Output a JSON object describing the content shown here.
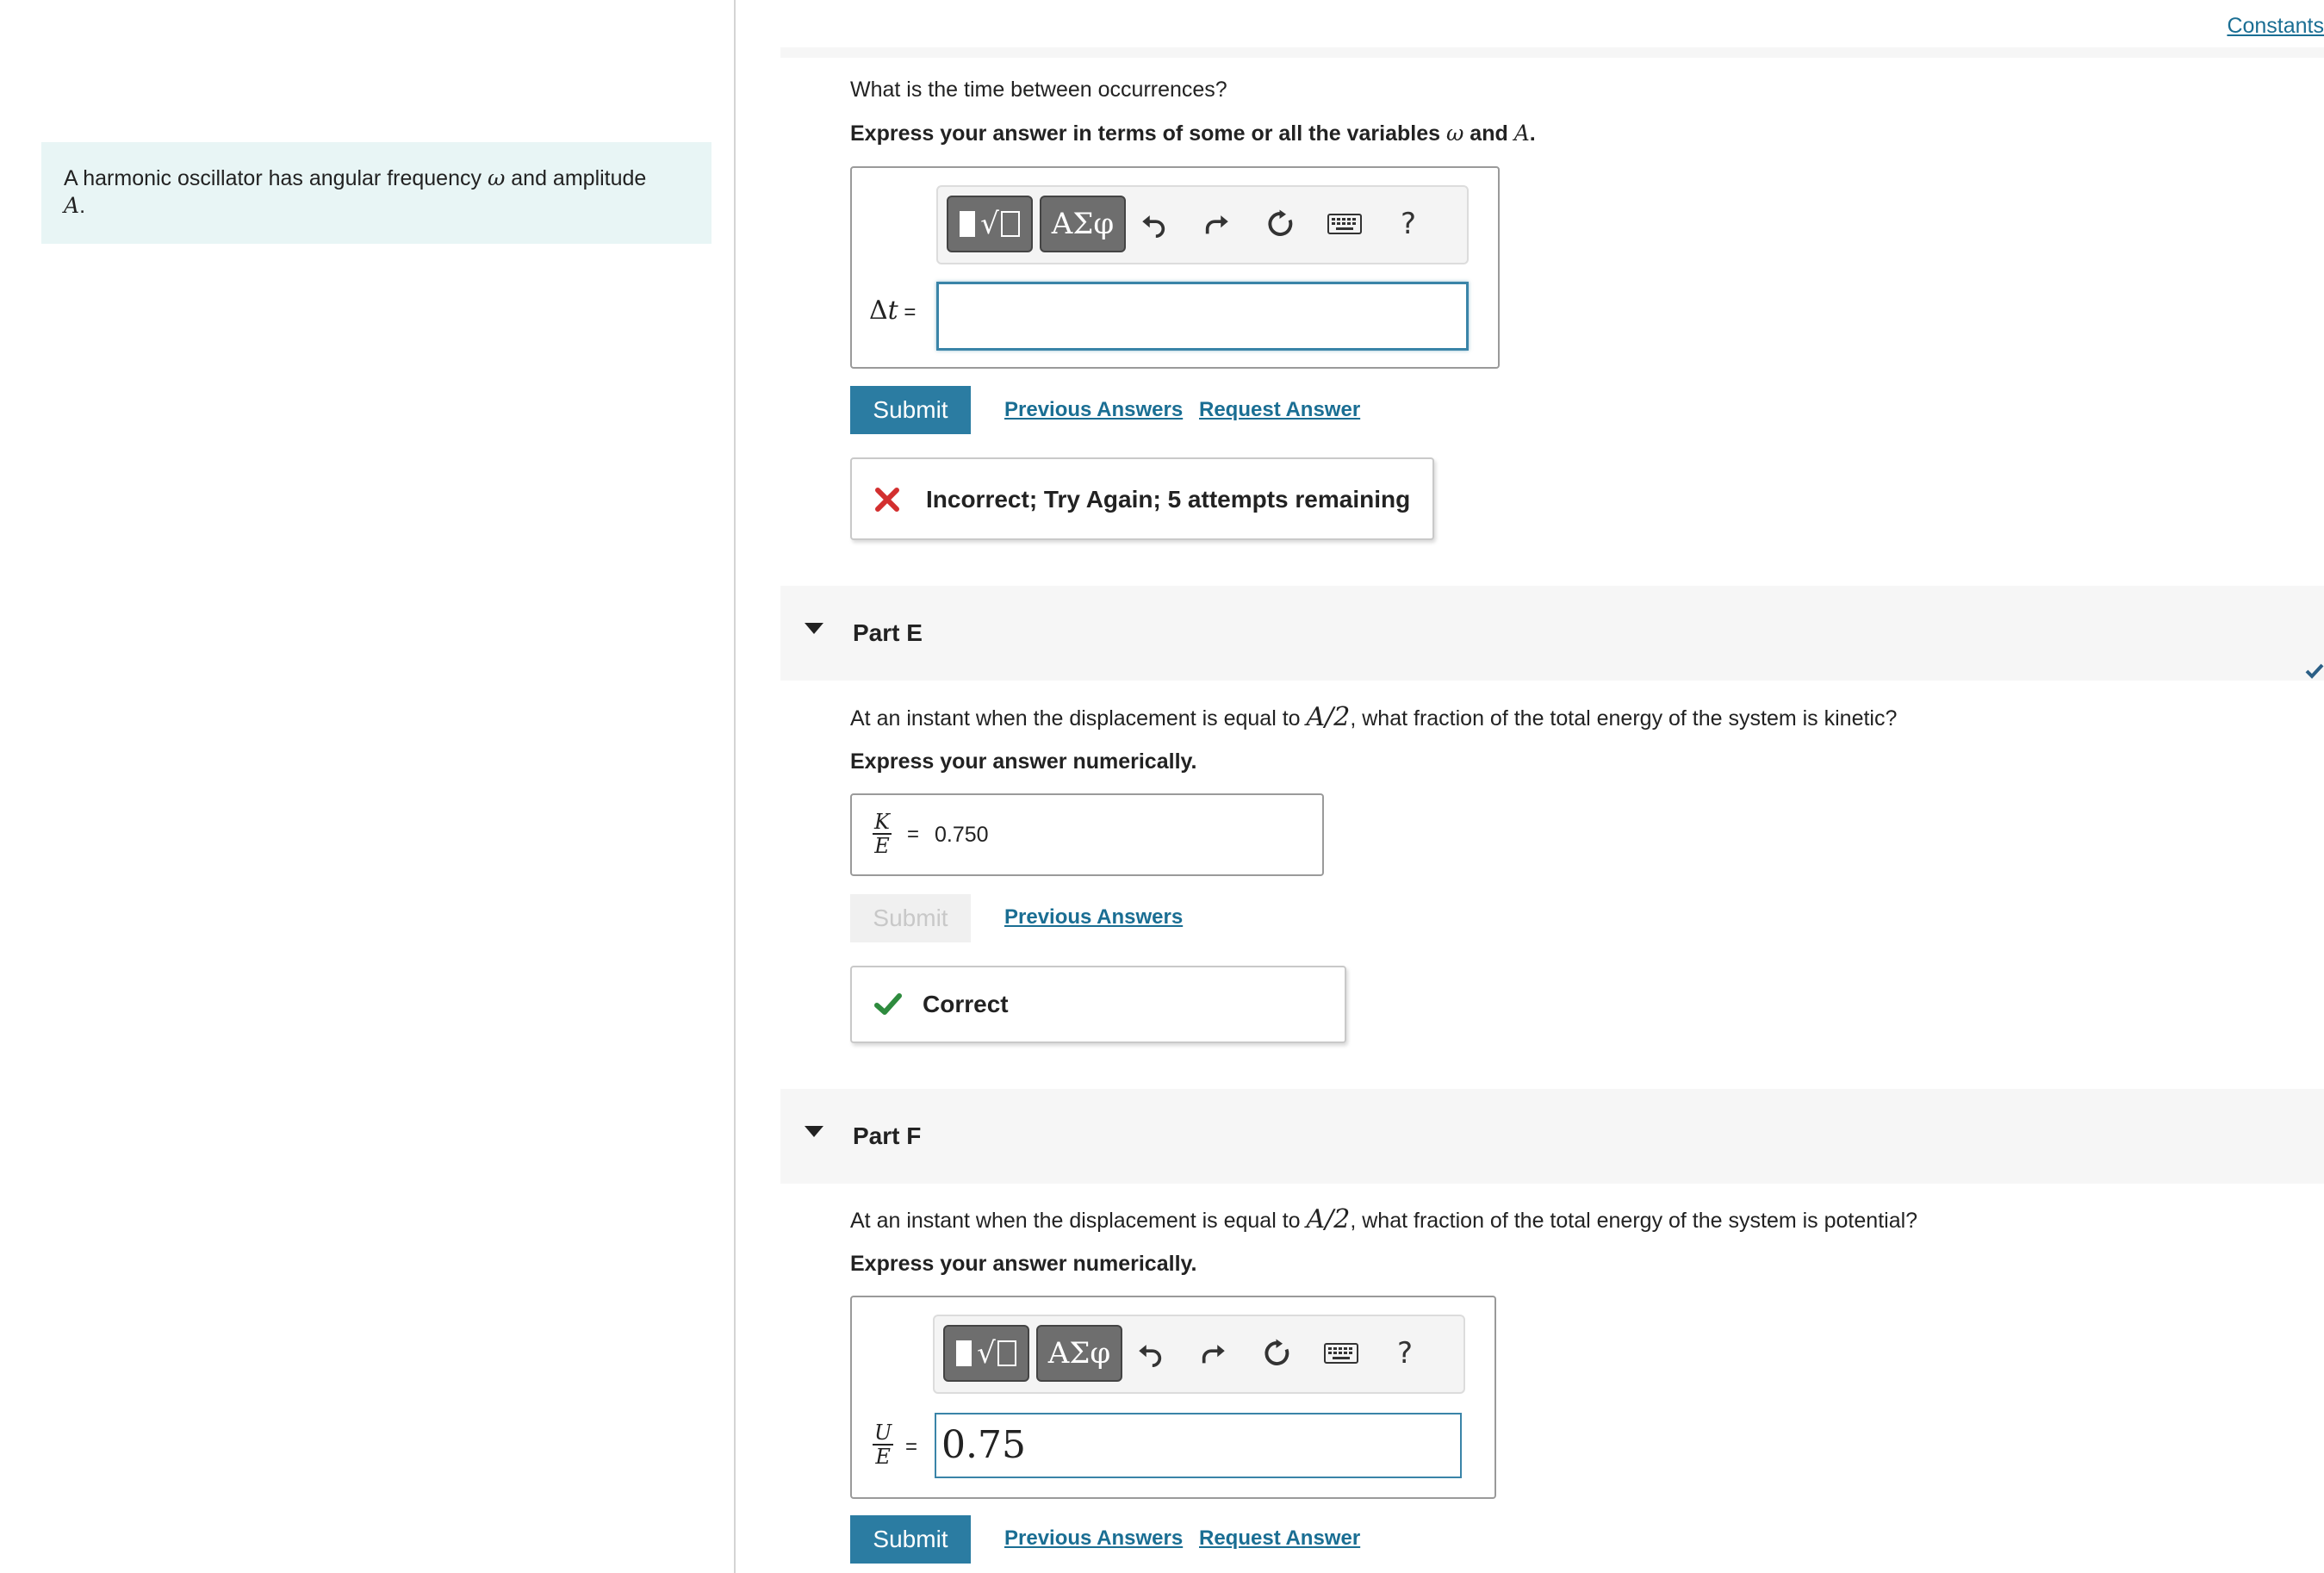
{
  "intro": {
    "text_before": "A harmonic oscillator has angular frequency ",
    "omega": "ω",
    "text_mid": " and amplitude ",
    "amp": "A",
    "text_end": "."
  },
  "header": {
    "constants_link": "Constants"
  },
  "toolbar": {
    "templates_label": "√",
    "symbols_label": "ΑΣφ",
    "help_label": "?"
  },
  "partD": {
    "question": "What is the time between occurrences?",
    "instruction_prefix": "Express your answer in terms of some or all the variables ",
    "instruction_omega": "ω",
    "instruction_and": " and ",
    "instruction_A": "A",
    "instruction_end": ".",
    "var_delta": "Δ",
    "var_t": "t",
    "equals": " =",
    "input_value": "",
    "submit_label": "Submit",
    "previous_answers": "Previous Answers",
    "request_answer": "Request Answer",
    "feedback": "Incorrect; Try Again; 5 attempts remaining"
  },
  "partE": {
    "title": "Part E",
    "q_prefix": "At an instant when the displacement is equal to ",
    "q_math": "A/2",
    "q_suffix": ", what fraction of the total energy of the system is kinetic?",
    "instruction": "Express your answer numerically.",
    "frac_num": "K",
    "frac_den": "E",
    "equals": "=",
    "answer": "0.750",
    "submit_label": "Submit",
    "previous_answers": "Previous Answers",
    "feedback": "Correct"
  },
  "partF": {
    "title": "Part F",
    "q_prefix": "At an instant when the displacement is equal to ",
    "q_math": "A/2",
    "q_suffix": ", what fraction of the total energy of the system is potential?",
    "instruction": "Express your answer numerically.",
    "frac_num": "U",
    "frac_den": "E",
    "equals": "=",
    "input_value": "0.75",
    "submit_label": "Submit",
    "previous_answers": "Previous Answers",
    "request_answer": "Request Answer"
  },
  "colors": {
    "accent": "#2b7ca2",
    "correct": "#2e8b3e",
    "incorrect": "#d32f2f",
    "intro_bg": "#e8f5f5"
  }
}
